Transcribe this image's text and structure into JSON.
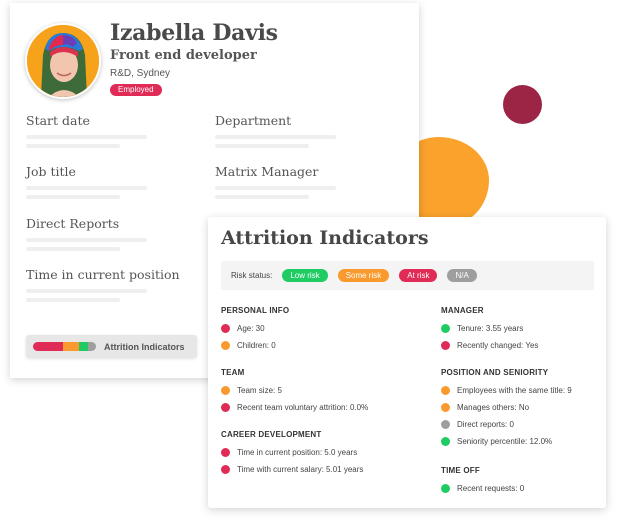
{
  "colors": {
    "red": "#E02B56",
    "orange": "#FA9A2E",
    "green": "#1FCB63",
    "gray": "#9E9E9E",
    "blob_orange": "#FAA22C",
    "blob_maroon": "#9C2545"
  },
  "profile": {
    "name": "Izabella Davis",
    "role": "Front end developer",
    "location": "R&D, Sydney",
    "status": "Employed",
    "fields": [
      {
        "label": "Start date"
      },
      {
        "label": "Department"
      },
      {
        "label": "Job title"
      },
      {
        "label": "Matrix Manager"
      },
      {
        "label": "Direct Reports"
      },
      {
        "label": "Time in current position"
      }
    ],
    "attrition_button": {
      "label": "Attrition Indicators",
      "segments": [
        {
          "status": "red",
          "fraction": 0.48
        },
        {
          "status": "orange",
          "fraction": 0.25
        },
        {
          "status": "green",
          "fraction": 0.14
        },
        {
          "status": "gray",
          "fraction": 0.13
        }
      ]
    }
  },
  "attrition": {
    "title": "Attrition Indicators",
    "risk_status_label": "Risk status:",
    "legend": [
      {
        "label": "Low risk",
        "status": "green"
      },
      {
        "label": "Some risk",
        "status": "orange"
      },
      {
        "label": "At risk",
        "status": "red"
      },
      {
        "label": "N/A",
        "status": "gray"
      }
    ],
    "sections": {
      "personal_info": {
        "title": "PERSONAL INFO",
        "items": [
          {
            "text": "Age: 30",
            "status": "red"
          },
          {
            "text": "Children: 0",
            "status": "orange"
          }
        ]
      },
      "team": {
        "title": "TEAM",
        "items": [
          {
            "text": "Team size: 5",
            "status": "orange"
          },
          {
            "text": "Recent team voluntary attrition: 0.0%",
            "status": "red"
          }
        ]
      },
      "career_development": {
        "title": "CAREER DEVELOPMENT",
        "items": [
          {
            "text": "Time in current position: 5.0 years",
            "status": "red"
          },
          {
            "text": "Time with current salary: 5.01 years",
            "status": "red"
          }
        ]
      },
      "manager": {
        "title": "MANAGER",
        "items": [
          {
            "text": "Tenure: 3.55 years",
            "status": "green"
          },
          {
            "text": "Recently changed: Yes",
            "status": "red"
          }
        ]
      },
      "position_seniority": {
        "title": "POSITION AND SENIORITY",
        "items": [
          {
            "text": "Employees with the same title: 9",
            "status": "orange"
          },
          {
            "text": "Manages others: No",
            "status": "orange"
          },
          {
            "text": "Direct reports: 0",
            "status": "gray"
          },
          {
            "text": "Seniority percentile: 12.0%",
            "status": "green"
          }
        ]
      },
      "time_off": {
        "title": "TIME OFF",
        "items": [
          {
            "text": "Recent requests: 0",
            "status": "green"
          }
        ]
      }
    }
  }
}
